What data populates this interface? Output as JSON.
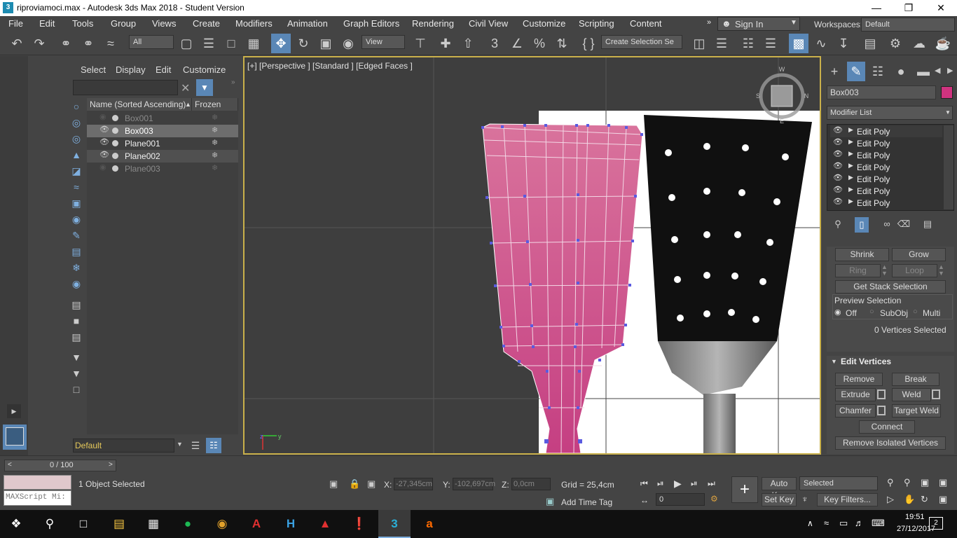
{
  "window": {
    "title": "riproviamoci.max - Autodesk 3ds Max 2018 - Student Version",
    "app_icon": "3"
  },
  "menubar": {
    "items": [
      "File",
      "Edit",
      "Tools",
      "Group",
      "Views",
      "Create",
      "Modifiers",
      "Animation",
      "Graph Editors",
      "Rendering",
      "Civil View",
      "Customize",
      "Scripting",
      "Content"
    ],
    "sign_in": "Sign In",
    "workspaces_label": "Workspaces:",
    "workspace": "Default"
  },
  "toolbar": {
    "filter": "All",
    "ref_coord": "View",
    "selection_set": "Create Selection Se"
  },
  "scene_explorer": {
    "tabs": [
      "Select",
      "Display",
      "Edit",
      "Customize"
    ],
    "col_name": "Name (Sorted Ascending)",
    "col_frozen": "Frozen",
    "objects": [
      {
        "name": "Box001",
        "dim": true,
        "selected": false
      },
      {
        "name": "Box003",
        "dim": false,
        "selected": true
      },
      {
        "name": "Plane001",
        "dim": false,
        "selected": false
      },
      {
        "name": "Plane002",
        "dim": false,
        "selected": false
      },
      {
        "name": "Plane003",
        "dim": true,
        "selected": false
      }
    ],
    "layer": "Default"
  },
  "viewport": {
    "label": "[+] [Perspective ] [Standard ] [Edged Faces ]"
  },
  "command_panel": {
    "object_name": "Box003",
    "object_color": "#d0337f",
    "modifier_list": "Modifier List",
    "stack": [
      "Edit Poly",
      "Edit Poly",
      "Edit Poly",
      "Edit Poly",
      "Edit Poly",
      "Edit Poly",
      "Edit Poly"
    ],
    "shrink": "Shrink",
    "grow": "Grow",
    "ring": "Ring",
    "loop": "Loop",
    "get_stack": "Get Stack Selection",
    "preview_label": "Preview Selection",
    "preview_off": "Off",
    "preview_subobj": "SubObj",
    "preview_multi": "Multi",
    "vertices_selected": "0 Vertices Selected",
    "rollout_title": "Edit Vertices",
    "remove": "Remove",
    "break": "Break",
    "extrude": "Extrude",
    "weld": "Weld",
    "chamfer": "Chamfer",
    "target_weld": "Target Weld",
    "connect": "Connect",
    "remove_isolated": "Remove Isolated Vertices"
  },
  "bottom": {
    "timeline": "0 / 100",
    "maxscript": "MAXScript Mi:",
    "status": "1 Object Selected",
    "x_label": "X:",
    "x_val": "-27,345cm",
    "y_label": "Y:",
    "y_val": "-102,697cm",
    "z_label": "Z:",
    "z_val": "0,0cm",
    "grid": "Grid = 25,4cm",
    "add_time_tag": "Add Time Tag",
    "auto_key": "Auto Key",
    "set_key": "Set Key",
    "selected": "Selected",
    "key_filters": "Key Filters...",
    "frame": "0"
  },
  "taskbar": {
    "time": "19:51",
    "date": "27/12/2017",
    "notif": "2"
  }
}
